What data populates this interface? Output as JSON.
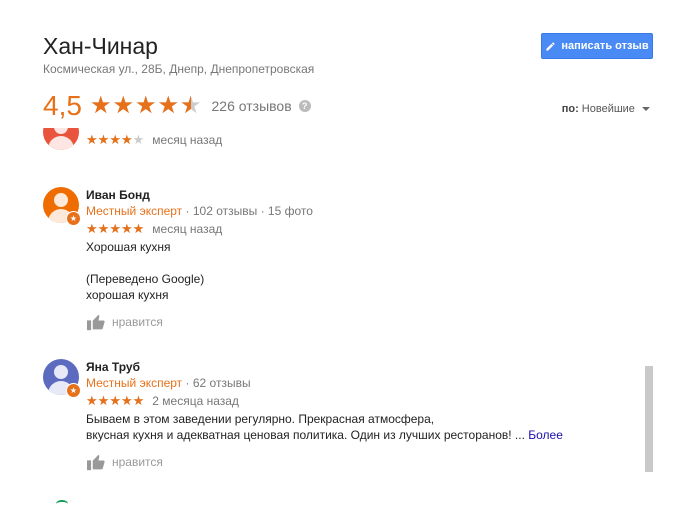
{
  "place": {
    "name": "Хан-Чинар",
    "address": "Космическая ул., 28Б, Днепр, Днепропетровская",
    "rating": "4,5",
    "rating_value": 4.5,
    "review_count": "226 отзывов",
    "help_icon": "?"
  },
  "write_review": {
    "label": "написать отзыв",
    "icon": "pencil-icon"
  },
  "sort": {
    "label": "по:",
    "value": "Новейшие"
  },
  "colors": {
    "accent": "#e7711b",
    "button": "#4a8af4",
    "link": "#1a0dab"
  },
  "reviews": [
    {
      "name": "",
      "stars": 4,
      "time": "месяц назад",
      "avatar_color": "#e8553c"
    },
    {
      "name": "Иван Бонд",
      "expert": "Местный эксперт",
      "stats": "· 102 отзывы · 15 фото",
      "stars": 5,
      "time": "месяц назад",
      "text1": "Хорошая кухня",
      "text2": "(Переведено Google)",
      "text3": "хорошая кухня",
      "like": "нравится",
      "avatar_color": "#ef6c00"
    },
    {
      "name": "Яна Труб",
      "expert": "Местный эксперт",
      "stats": "· 62 отзывы",
      "stars": 5,
      "time": "2 месяца назад",
      "text1": "Бываем в этом заведении регулярно. Прекрасная атмосфера,",
      "text2": "вкусная кухня и адекватная ценовая политика. Один из лучших ресторанов! ...",
      "more": "Более",
      "like": "нравится",
      "avatar_color": "#5c6bc0"
    }
  ]
}
